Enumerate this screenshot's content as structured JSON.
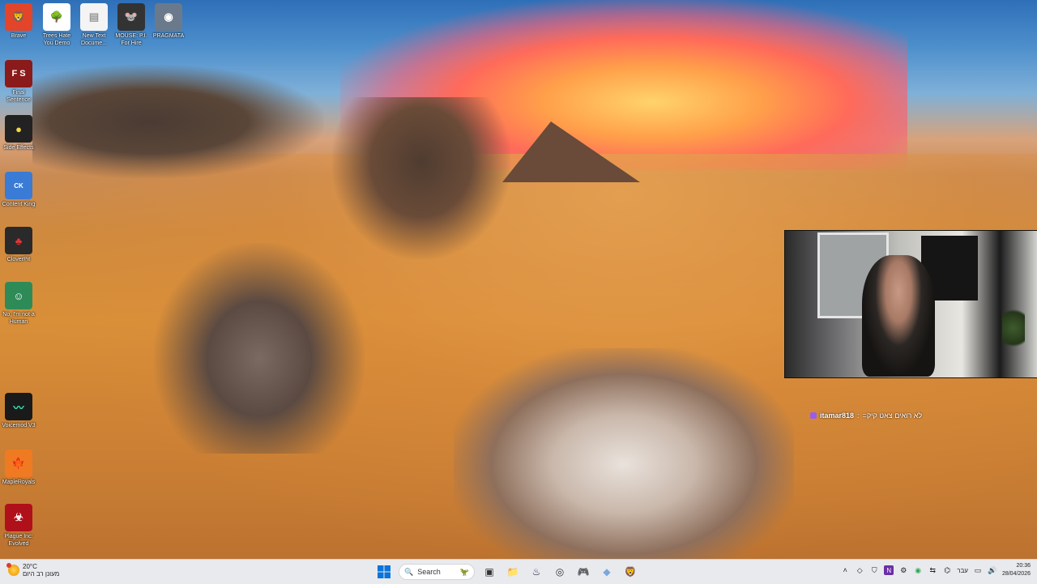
{
  "desktop": {
    "icons": [
      {
        "label": "Brave",
        "icon": "brave-lion-icon",
        "color": "#e2452a"
      },
      {
        "label": "Trees Hate You Demo",
        "icon": "tree-icon",
        "color": "#ffffff"
      },
      {
        "label": "New Text Docume...",
        "icon": "text-document-icon",
        "color": "#f4f4f4"
      },
      {
        "label": "MOUSE: P.I. For Hire",
        "icon": "mouse-game-icon",
        "color": "#333333"
      },
      {
        "label": "PRAGMATA",
        "icon": "pragmata-icon",
        "color": "#6a7a8c"
      },
      {
        "label": "Final Sentence",
        "icon": "final-sentence-icon",
        "color": "#8b1a1a"
      },
      {
        "label": "Side Effects",
        "icon": "side-effects-icon",
        "color": "#222222"
      },
      {
        "label": "Content King",
        "icon": "content-king-icon",
        "color": "#3a7bd5"
      },
      {
        "label": "CloverPit",
        "icon": "cloverpit-icon",
        "color": "#2a2a2a"
      },
      {
        "label": "No, I'm not a Human",
        "icon": "no-human-icon",
        "color": "#2e8b57"
      },
      {
        "label": "Voicemod V3",
        "icon": "voicemod-icon",
        "color": "#1a1a1a"
      },
      {
        "label": "MapleRoyals",
        "icon": "mapleroyals-icon",
        "color": "#f07a22"
      },
      {
        "label": "Plague Inc: Evolved",
        "icon": "plague-inc-icon",
        "color": "#b0101a"
      }
    ]
  },
  "webcam": {
    "chat_user": "itamar818",
    "chat_message": "=לא רואים צאט קיק"
  },
  "taskbar": {
    "weather_temp": "20°C",
    "weather_text": "מעונן רב היום",
    "search_label": "Search",
    "lang": "עבר",
    "time": "20:36",
    "date": "28/04/2026"
  }
}
